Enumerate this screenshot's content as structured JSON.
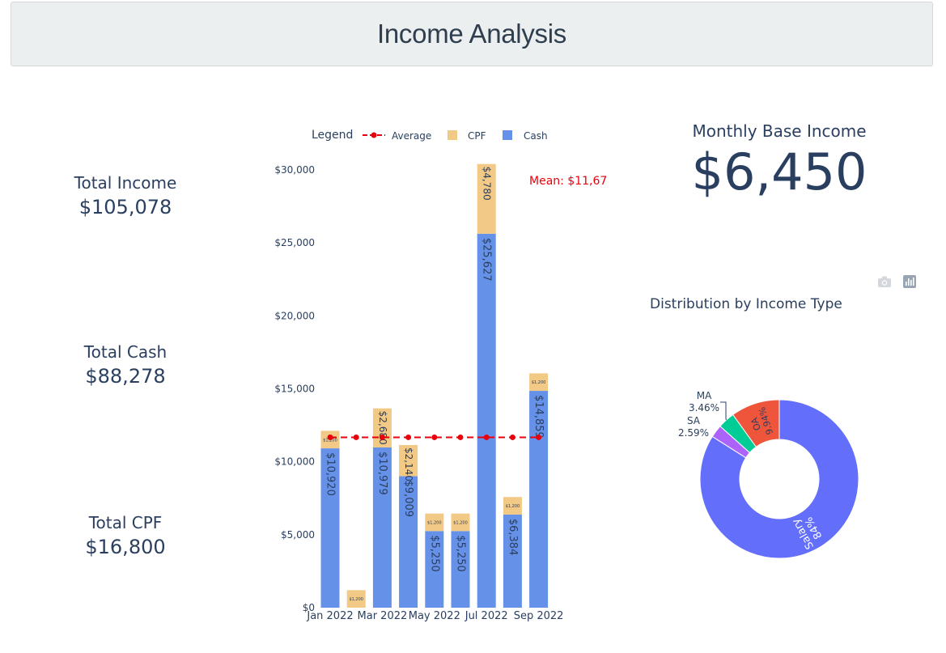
{
  "header": {
    "title": "Income Analysis"
  },
  "stats": [
    {
      "label": "Total Income",
      "value": "$105,078"
    },
    {
      "label": "Total Cash",
      "value": "$88,278"
    },
    {
      "label": "Total CPF",
      "value": "$16,800"
    }
  ],
  "base_income": {
    "label": "Monthly Base Income",
    "value": "$6,450"
  },
  "modebar": {
    "icons": [
      "camera-icon",
      "plotly-logo-icon"
    ]
  },
  "colors": {
    "cash": "#6591e8",
    "cpf": "#f2c985",
    "average": "#e8000b",
    "text": "#2a3f5f"
  },
  "chart_data": [
    {
      "type": "bar",
      "barmode": "stack",
      "legend_title": "Legend",
      "legend_position": "top",
      "x": [
        "Jan 2022",
        "Feb 2022",
        "Mar 2022",
        "Apr 2022",
        "May 2022",
        "Jun 2022",
        "Jul 2022",
        "Aug 2022",
        "Sep 2022"
      ],
      "xticks": [
        "Jan 2022",
        "Mar 2022",
        "May 2022",
        "Jul 2022",
        "Sep 2022"
      ],
      "ylim": [
        0,
        30500
      ],
      "yticks": [
        0,
        5000,
        10000,
        15000,
        20000,
        25000,
        30000
      ],
      "ytick_labels": [
        "$0",
        "$5,000",
        "$10,000",
        "$15,000",
        "$20,000",
        "$25,000",
        "$30,000"
      ],
      "series": [
        {
          "name": "Cash",
          "color": "#6591e8",
          "values": [
            10920,
            0,
            10979,
            9009,
            5250,
            5250,
            25627,
            6384,
            14859
          ],
          "labels": [
            "$10,920",
            "",
            "$10,979",
            "$9,009",
            "$5,250",
            "$5,250",
            "$25,627",
            "$6,384",
            "$14,859"
          ]
        },
        {
          "name": "CPF",
          "color": "#f2c985",
          "values": [
            1200,
            1200,
            2680,
            2140,
            1200,
            1200,
            4780,
            1200,
            1200
          ],
          "labels": [
            "$1,200",
            "$1,200",
            "$2,680",
            "$2,140",
            "$1,200",
            "$1,200",
            "$4,780",
            "$1,200",
            "$1,200"
          ]
        },
        {
          "name": "Average",
          "color": "#e8000b",
          "style": "dashed-line-markers",
          "values": [
            11675,
            11675,
            11675,
            11675,
            11675,
            11675,
            11675,
            11675,
            11675
          ]
        }
      ],
      "annotation": "Mean: $11,67"
    },
    {
      "type": "pie",
      "hole": true,
      "title": "Distribution by Income Type",
      "slices": [
        {
          "label": "Salary",
          "percent": "84%",
          "value": 84.01,
          "color": "#636efa"
        },
        {
          "label": "SA",
          "percent": "2.59%",
          "value": 2.59,
          "color": "#ab63fa"
        },
        {
          "label": "MA",
          "percent": "3.46%",
          "value": 3.46,
          "color": "#00cc96"
        },
        {
          "label": "OA",
          "percent": "9.94%",
          "value": 9.94,
          "color": "#ef553b"
        }
      ]
    }
  ]
}
